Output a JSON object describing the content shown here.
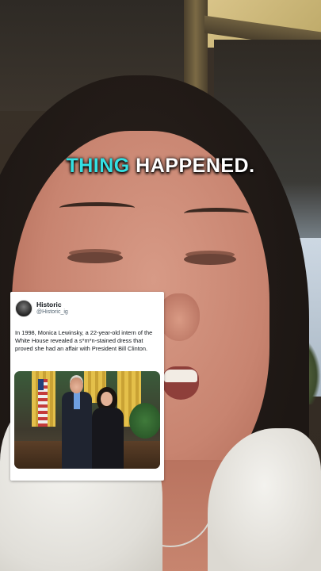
{
  "caption": {
    "highlight": "THING",
    "rest": " HAPPENED.",
    "highlight_color": "#35e0e3"
  },
  "tweet": {
    "avatar_icon": "profile-avatar",
    "display_name": "Historic",
    "handle": "@Historic_ig",
    "text": "In 1998, Monica Lewinsky, a 22-year-old intern of the White House revealed a s*m*n-stained dress that proved she had an affair with President Bill Clinton.",
    "photo_subject": "oval-office-photo"
  }
}
